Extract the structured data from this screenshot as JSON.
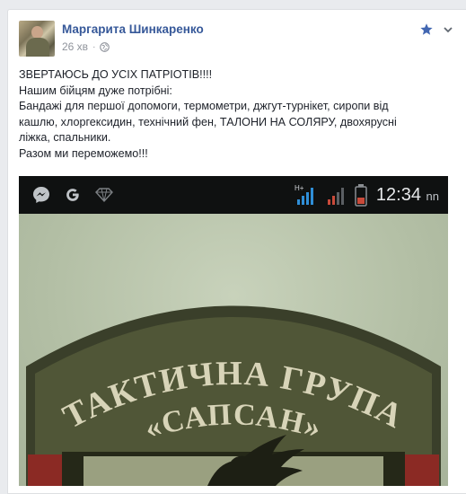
{
  "post": {
    "author": "Маргарита Шинкаренко",
    "time": "26 хв",
    "separator": "·",
    "privacy_icon": "globe-icon",
    "actions": {
      "favorite_icon": "star-icon",
      "menu_icon": "chevron-down-icon"
    },
    "text_lines": [
      "ЗВЕРТАЮСЬ ДО УСІХ ПАТРІОТІВ!!!!",
      "Нашим бійцям дуже потрібні:",
      "Бандажі для першої допомоги, термометри, джгут-турнікет, сиропи від",
      "кашлю, хлоргексидин, технічний фен, ТАЛОНИ НА СОЛЯРУ, двохярусні",
      "ліжка, спальники.",
      "Разом ми переможемо!!!"
    ]
  },
  "image": {
    "statusbar": {
      "left_icons": [
        "messenger-icon",
        "google-icon",
        "diamond-icon"
      ],
      "right_icons": [
        "signal-icon",
        "signal-icon",
        "battery-icon"
      ],
      "signal_label": "H+",
      "time": "12:34",
      "time_suffix": "nn"
    },
    "patch": {
      "line1": "ТАКТИЧНА ГРУПА",
      "line2": "«САПСАН»"
    }
  },
  "colors": {
    "link": "#365899",
    "meta": "#90949c",
    "star": "#4267b2"
  }
}
